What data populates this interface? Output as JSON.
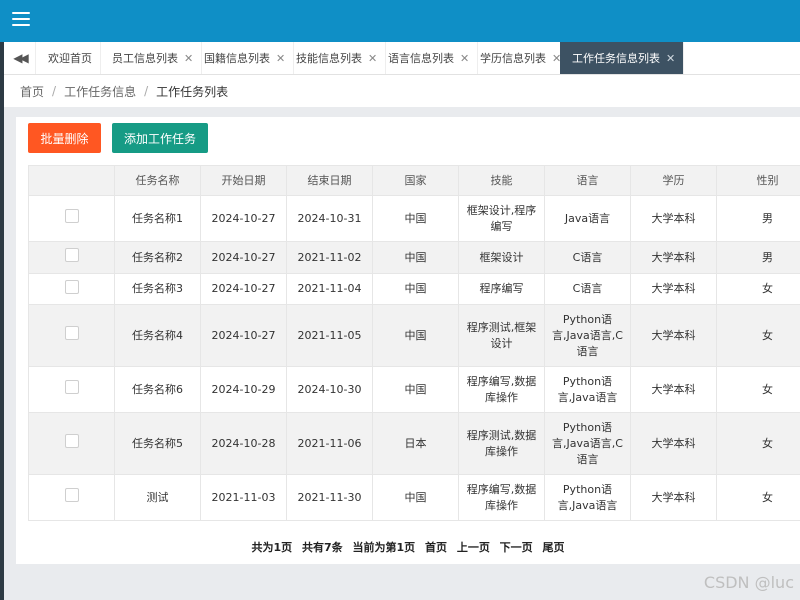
{
  "tabs": [
    {
      "label": "欢迎首页",
      "closable": false
    },
    {
      "label": "员工信息列表",
      "closable": true
    },
    {
      "label": "国籍信息列表",
      "closable": true
    },
    {
      "label": "技能信息列表",
      "closable": true
    },
    {
      "label": "语言信息列表",
      "closable": true
    },
    {
      "label": "学历信息列表",
      "closable": true
    },
    {
      "label": "工作任务信息列表",
      "closable": true,
      "active": true
    }
  ],
  "breadcrumb": [
    "首页",
    "工作任务信息",
    "工作任务列表"
  ],
  "toolbar": {
    "batch_delete": "批量删除",
    "add_task": "添加工作任务"
  },
  "table": {
    "headers": [
      "任务名称",
      "开始日期",
      "结束日期",
      "国家",
      "技能",
      "语言",
      "学历",
      "性别"
    ],
    "rows": [
      [
        "任务名称1",
        "2024-10-27",
        "2024-10-31",
        "中国",
        "框架设计,程序编写",
        "Java语言",
        "大学本科",
        "男"
      ],
      [
        "任务名称2",
        "2024-10-27",
        "2021-11-02",
        "中国",
        "框架设计",
        "C语言",
        "大学本科",
        "男"
      ],
      [
        "任务名称3",
        "2024-10-27",
        "2021-11-04",
        "中国",
        "程序编写",
        "C语言",
        "大学本科",
        "女"
      ],
      [
        "任务名称4",
        "2024-10-27",
        "2021-11-05",
        "中国",
        "程序测试,框架设计",
        "Python语言,Java语言,C语言",
        "大学本科",
        "女"
      ],
      [
        "任务名称6",
        "2024-10-29",
        "2024-10-30",
        "中国",
        "程序编写,数据库操作",
        "Python语言,Java语言",
        "大学本科",
        "女"
      ],
      [
        "任务名称5",
        "2024-10-28",
        "2021-11-06",
        "日本",
        "程序测试,数据库操作",
        "Python语言,Java语言,C语言",
        "大学本科",
        "女"
      ],
      [
        "测试",
        "2021-11-03",
        "2021-11-30",
        "中国",
        "程序编写,数据库操作",
        "Python语言,Java语言",
        "大学本科",
        "女"
      ]
    ]
  },
  "pager": {
    "total_pages": "共为1页",
    "total_records": "共有7条",
    "current": "当前为第1页",
    "first": "首页",
    "prev": "上一页",
    "next": "下一页",
    "last": "尾页"
  },
  "watermark": "CSDN @luc",
  "icons": {
    "menu": "hamburger-icon",
    "tab_prev": "double-chevron-left-icon",
    "close": "close-icon",
    "checkbox": "checkbox-icon"
  },
  "colors": {
    "topbar": "#0f8fc6",
    "active_tab": "#3d5263",
    "danger": "#ff5722",
    "primary": "#169b85"
  }
}
